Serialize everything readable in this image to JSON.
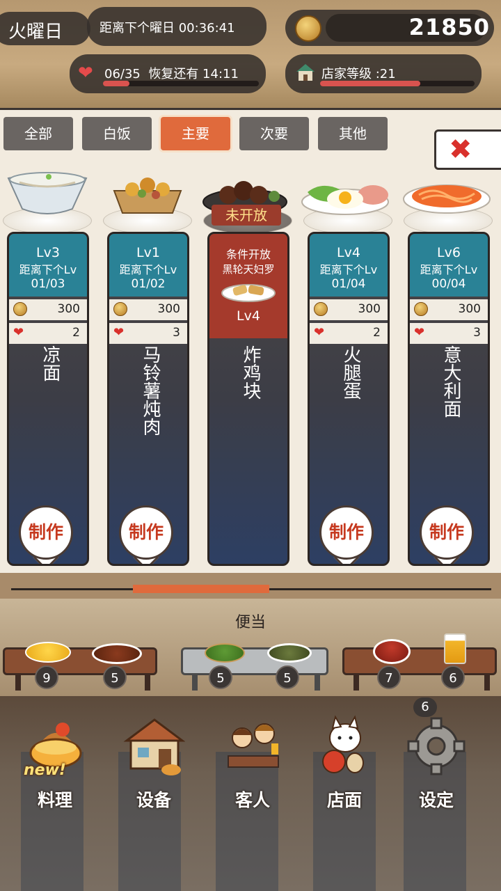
{
  "hud": {
    "day": "火曜日",
    "timer": "距离下个曜日 00:36:41",
    "gold": "21850",
    "stamina": "06/35",
    "recover": "恢复还有  14:11",
    "stamina_fill": 0.17,
    "shop_level": "店家等级 :21",
    "shop_level_fill": 0.65
  },
  "tabs": [
    "全部",
    "白饭",
    "主要",
    "次要",
    "其他"
  ],
  "active_tab": "主要",
  "dishes": [
    {
      "lv": "Lv3",
      "next": "距离下个Lv",
      "progress": "01/03",
      "cost": "300",
      "hearts": "2",
      "name": "凉面",
      "make": "制作"
    },
    {
      "lv": "Lv1",
      "next": "距离下个Lv",
      "progress": "01/02",
      "cost": "300",
      "hearts": "3",
      "name": "马铃薯炖肉",
      "make": "制作"
    },
    {
      "locked": "未开放",
      "cond": "条件开放",
      "cond_item": "黑轮天妇罗",
      "lv": "Lv4",
      "name": "炸鸡块"
    },
    {
      "lv": "Lv4",
      "next": "距离下个Lv",
      "progress": "01/04",
      "cost": "300",
      "hearts": "2",
      "name": "火腿蛋",
      "make": "制作"
    },
    {
      "lv": "Lv6",
      "next": "距离下个Lv",
      "progress": "00/04",
      "cost": "300",
      "hearts": "3",
      "name": "意大利面",
      "make": "制作"
    }
  ],
  "scroll_position": 0.25,
  "bento": {
    "title": "便当",
    "counts": [
      "9",
      "5",
      "5",
      "5",
      "7",
      "6"
    ]
  },
  "nav": {
    "items": [
      "料理",
      "设备",
      "客人",
      "店面",
      "设定"
    ],
    "new_label": "new!",
    "settings_count": "6"
  },
  "colors": {
    "accent": "#e06a3c",
    "card_header": "#2a8296",
    "locked": "#a53a2c"
  }
}
